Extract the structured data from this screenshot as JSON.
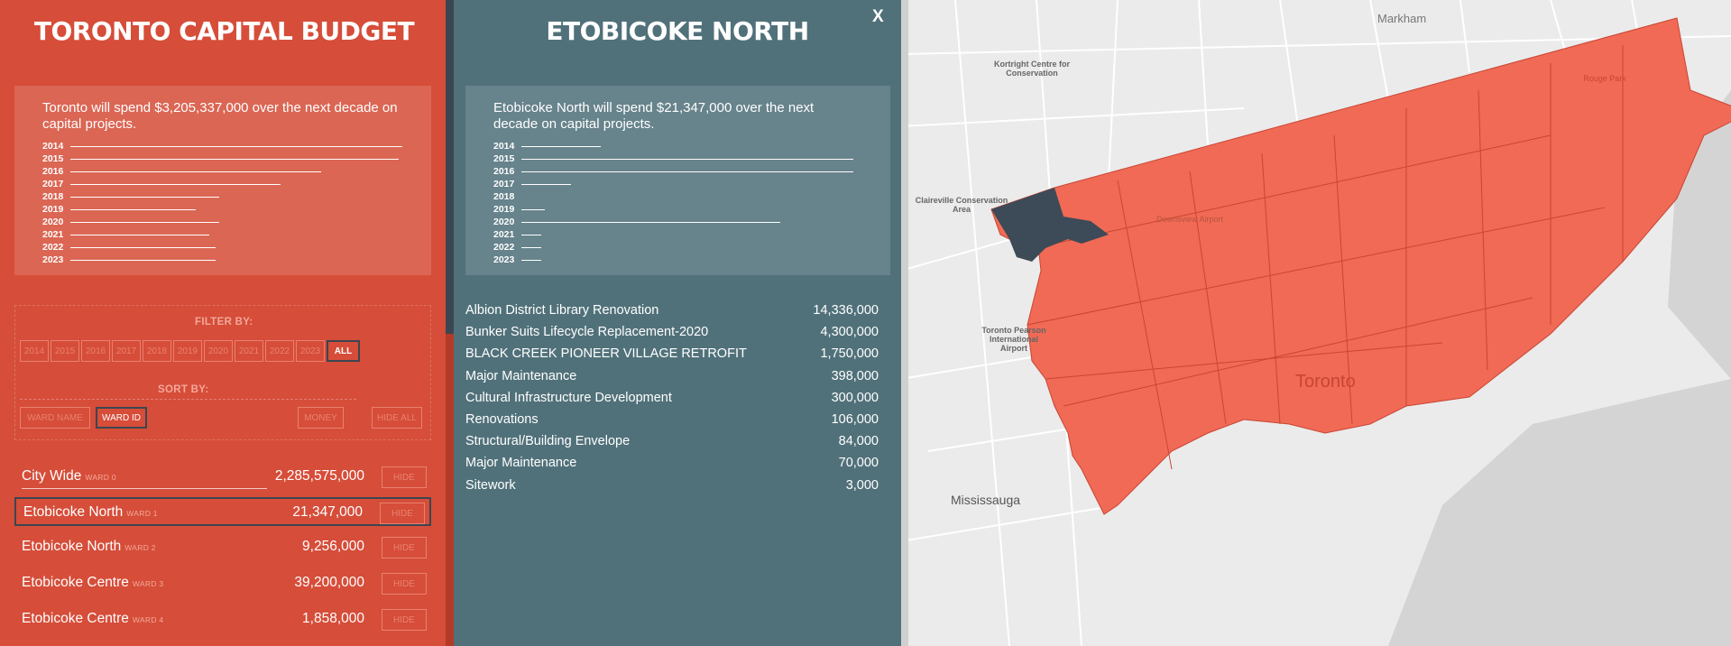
{
  "left": {
    "title": "TORONTO CAPITAL BUDGET",
    "summary": "Toronto will spend $3,205,337,000 over the next decade on capital projects.",
    "years": [
      {
        "year": "2014",
        "fraction": 0.98
      },
      {
        "year": "2015",
        "fraction": 0.97
      },
      {
        "year": "2016",
        "fraction": 0.74
      },
      {
        "year": "2017",
        "fraction": 0.62
      },
      {
        "year": "2018",
        "fraction": 0.44
      },
      {
        "year": "2019",
        "fraction": 0.37
      },
      {
        "year": "2020",
        "fraction": 0.44
      },
      {
        "year": "2021",
        "fraction": 0.41
      },
      {
        "year": "2022",
        "fraction": 0.43
      },
      {
        "year": "2023",
        "fraction": 0.43
      }
    ],
    "filter_label": "FILTER BY:",
    "filter_buttons": [
      "2014",
      "2015",
      "2016",
      "2017",
      "2018",
      "2019",
      "2020",
      "2021",
      "2022",
      "2023",
      "ALL"
    ],
    "active_filter": "ALL",
    "sort_label": "SORT BY:",
    "sort_buttons": [
      "WARD NAME",
      "WARD ID",
      "MONEY",
      "HIDE ALL"
    ],
    "active_sort": "WARD ID",
    "wards": [
      {
        "name": "City Wide",
        "ward": "WARD 0",
        "amount": "2,285,575,000",
        "hide": "HIDE"
      },
      {
        "name": "Etobicoke North",
        "ward": "WARD 1",
        "amount": "21,347,000",
        "hide": "HIDE"
      },
      {
        "name": "Etobicoke North",
        "ward": "WARD 2",
        "amount": "9,256,000",
        "hide": "HIDE"
      },
      {
        "name": "Etobicoke Centre",
        "ward": "WARD 3",
        "amount": "39,200,000",
        "hide": "HIDE"
      },
      {
        "name": "Etobicoke Centre",
        "ward": "WARD 4",
        "amount": "1,858,000",
        "hide": "HIDE"
      }
    ]
  },
  "detail": {
    "title": "ETOBICOKE NORTH",
    "close": "X",
    "summary": "Etobicoke North will spend $21,347,000 over the next decade on capital projects.",
    "years": [
      {
        "year": "2014",
        "fraction": 0.24
      },
      {
        "year": "2015",
        "fraction": 1.0
      },
      {
        "year": "2016",
        "fraction": 1.0
      },
      {
        "year": "2017",
        "fraction": 0.15
      },
      {
        "year": "2018",
        "fraction": 0.0
      },
      {
        "year": "2019",
        "fraction": 0.07
      },
      {
        "year": "2020",
        "fraction": 0.78
      },
      {
        "year": "2021",
        "fraction": 0.06
      },
      {
        "year": "2022",
        "fraction": 0.06
      },
      {
        "year": "2023",
        "fraction": 0.06
      }
    ],
    "projects": [
      {
        "name": "Albion District Library Renovation",
        "amount": "14,336,000"
      },
      {
        "name": "Bunker Suits Lifecycle Replacement-2020",
        "amount": "4,300,000"
      },
      {
        "name": "BLACK CREEK PIONEER VILLAGE RETROFIT",
        "amount": "1,750,000"
      },
      {
        "name": "Major Maintenance",
        "amount": "398,000"
      },
      {
        "name": "Cultural Infrastructure Development",
        "amount": "300,000"
      },
      {
        "name": "Renovations",
        "amount": "106,000"
      },
      {
        "name": "Structural/Building Envelope",
        "amount": "84,000"
      },
      {
        "name": "Major Maintenance",
        "amount": "70,000"
      },
      {
        "name": "Sitework",
        "amount": "3,000"
      }
    ]
  },
  "map": {
    "labels": {
      "markham": "Markham",
      "kortright": "Kortright Centre for Conservation",
      "claireville": "Claireville Conservation Area",
      "downsview": "Downsview Airport",
      "pearson": "Toronto Pearson International Airport",
      "toronto": "Toronto",
      "mississauga": "Mississauga",
      "rouge": "Rouge Park"
    },
    "colors": {
      "city": "#f06a55",
      "selected_ward": "#3d4a57",
      "water": "#d4d4d4",
      "land": "#ebebeb"
    }
  }
}
